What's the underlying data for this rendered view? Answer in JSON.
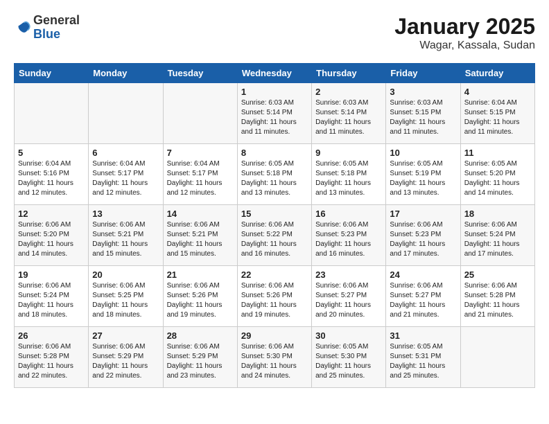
{
  "logo": {
    "general": "General",
    "blue": "Blue"
  },
  "title": "January 2025",
  "subtitle": "Wagar, Kassala, Sudan",
  "weekdays": [
    "Sunday",
    "Monday",
    "Tuesday",
    "Wednesday",
    "Thursday",
    "Friday",
    "Saturday"
  ],
  "weeks": [
    [
      {
        "day": "",
        "info": ""
      },
      {
        "day": "",
        "info": ""
      },
      {
        "day": "",
        "info": ""
      },
      {
        "day": "1",
        "info": "Sunrise: 6:03 AM\nSunset: 5:14 PM\nDaylight: 11 hours\nand 11 minutes."
      },
      {
        "day": "2",
        "info": "Sunrise: 6:03 AM\nSunset: 5:14 PM\nDaylight: 11 hours\nand 11 minutes."
      },
      {
        "day": "3",
        "info": "Sunrise: 6:03 AM\nSunset: 5:15 PM\nDaylight: 11 hours\nand 11 minutes."
      },
      {
        "day": "4",
        "info": "Sunrise: 6:04 AM\nSunset: 5:15 PM\nDaylight: 11 hours\nand 11 minutes."
      }
    ],
    [
      {
        "day": "5",
        "info": "Sunrise: 6:04 AM\nSunset: 5:16 PM\nDaylight: 11 hours\nand 12 minutes."
      },
      {
        "day": "6",
        "info": "Sunrise: 6:04 AM\nSunset: 5:17 PM\nDaylight: 11 hours\nand 12 minutes."
      },
      {
        "day": "7",
        "info": "Sunrise: 6:04 AM\nSunset: 5:17 PM\nDaylight: 11 hours\nand 12 minutes."
      },
      {
        "day": "8",
        "info": "Sunrise: 6:05 AM\nSunset: 5:18 PM\nDaylight: 11 hours\nand 13 minutes."
      },
      {
        "day": "9",
        "info": "Sunrise: 6:05 AM\nSunset: 5:18 PM\nDaylight: 11 hours\nand 13 minutes."
      },
      {
        "day": "10",
        "info": "Sunrise: 6:05 AM\nSunset: 5:19 PM\nDaylight: 11 hours\nand 13 minutes."
      },
      {
        "day": "11",
        "info": "Sunrise: 6:05 AM\nSunset: 5:20 PM\nDaylight: 11 hours\nand 14 minutes."
      }
    ],
    [
      {
        "day": "12",
        "info": "Sunrise: 6:06 AM\nSunset: 5:20 PM\nDaylight: 11 hours\nand 14 minutes."
      },
      {
        "day": "13",
        "info": "Sunrise: 6:06 AM\nSunset: 5:21 PM\nDaylight: 11 hours\nand 15 minutes."
      },
      {
        "day": "14",
        "info": "Sunrise: 6:06 AM\nSunset: 5:21 PM\nDaylight: 11 hours\nand 15 minutes."
      },
      {
        "day": "15",
        "info": "Sunrise: 6:06 AM\nSunset: 5:22 PM\nDaylight: 11 hours\nand 16 minutes."
      },
      {
        "day": "16",
        "info": "Sunrise: 6:06 AM\nSunset: 5:23 PM\nDaylight: 11 hours\nand 16 minutes."
      },
      {
        "day": "17",
        "info": "Sunrise: 6:06 AM\nSunset: 5:23 PM\nDaylight: 11 hours\nand 17 minutes."
      },
      {
        "day": "18",
        "info": "Sunrise: 6:06 AM\nSunset: 5:24 PM\nDaylight: 11 hours\nand 17 minutes."
      }
    ],
    [
      {
        "day": "19",
        "info": "Sunrise: 6:06 AM\nSunset: 5:24 PM\nDaylight: 11 hours\nand 18 minutes."
      },
      {
        "day": "20",
        "info": "Sunrise: 6:06 AM\nSunset: 5:25 PM\nDaylight: 11 hours\nand 18 minutes."
      },
      {
        "day": "21",
        "info": "Sunrise: 6:06 AM\nSunset: 5:26 PM\nDaylight: 11 hours\nand 19 minutes."
      },
      {
        "day": "22",
        "info": "Sunrise: 6:06 AM\nSunset: 5:26 PM\nDaylight: 11 hours\nand 19 minutes."
      },
      {
        "day": "23",
        "info": "Sunrise: 6:06 AM\nSunset: 5:27 PM\nDaylight: 11 hours\nand 20 minutes."
      },
      {
        "day": "24",
        "info": "Sunrise: 6:06 AM\nSunset: 5:27 PM\nDaylight: 11 hours\nand 21 minutes."
      },
      {
        "day": "25",
        "info": "Sunrise: 6:06 AM\nSunset: 5:28 PM\nDaylight: 11 hours\nand 21 minutes."
      }
    ],
    [
      {
        "day": "26",
        "info": "Sunrise: 6:06 AM\nSunset: 5:28 PM\nDaylight: 11 hours\nand 22 minutes."
      },
      {
        "day": "27",
        "info": "Sunrise: 6:06 AM\nSunset: 5:29 PM\nDaylight: 11 hours\nand 22 minutes."
      },
      {
        "day": "28",
        "info": "Sunrise: 6:06 AM\nSunset: 5:29 PM\nDaylight: 11 hours\nand 23 minutes."
      },
      {
        "day": "29",
        "info": "Sunrise: 6:06 AM\nSunset: 5:30 PM\nDaylight: 11 hours\nand 24 minutes."
      },
      {
        "day": "30",
        "info": "Sunrise: 6:05 AM\nSunset: 5:30 PM\nDaylight: 11 hours\nand 25 minutes."
      },
      {
        "day": "31",
        "info": "Sunrise: 6:05 AM\nSunset: 5:31 PM\nDaylight: 11 hours\nand 25 minutes."
      },
      {
        "day": "",
        "info": ""
      }
    ]
  ]
}
